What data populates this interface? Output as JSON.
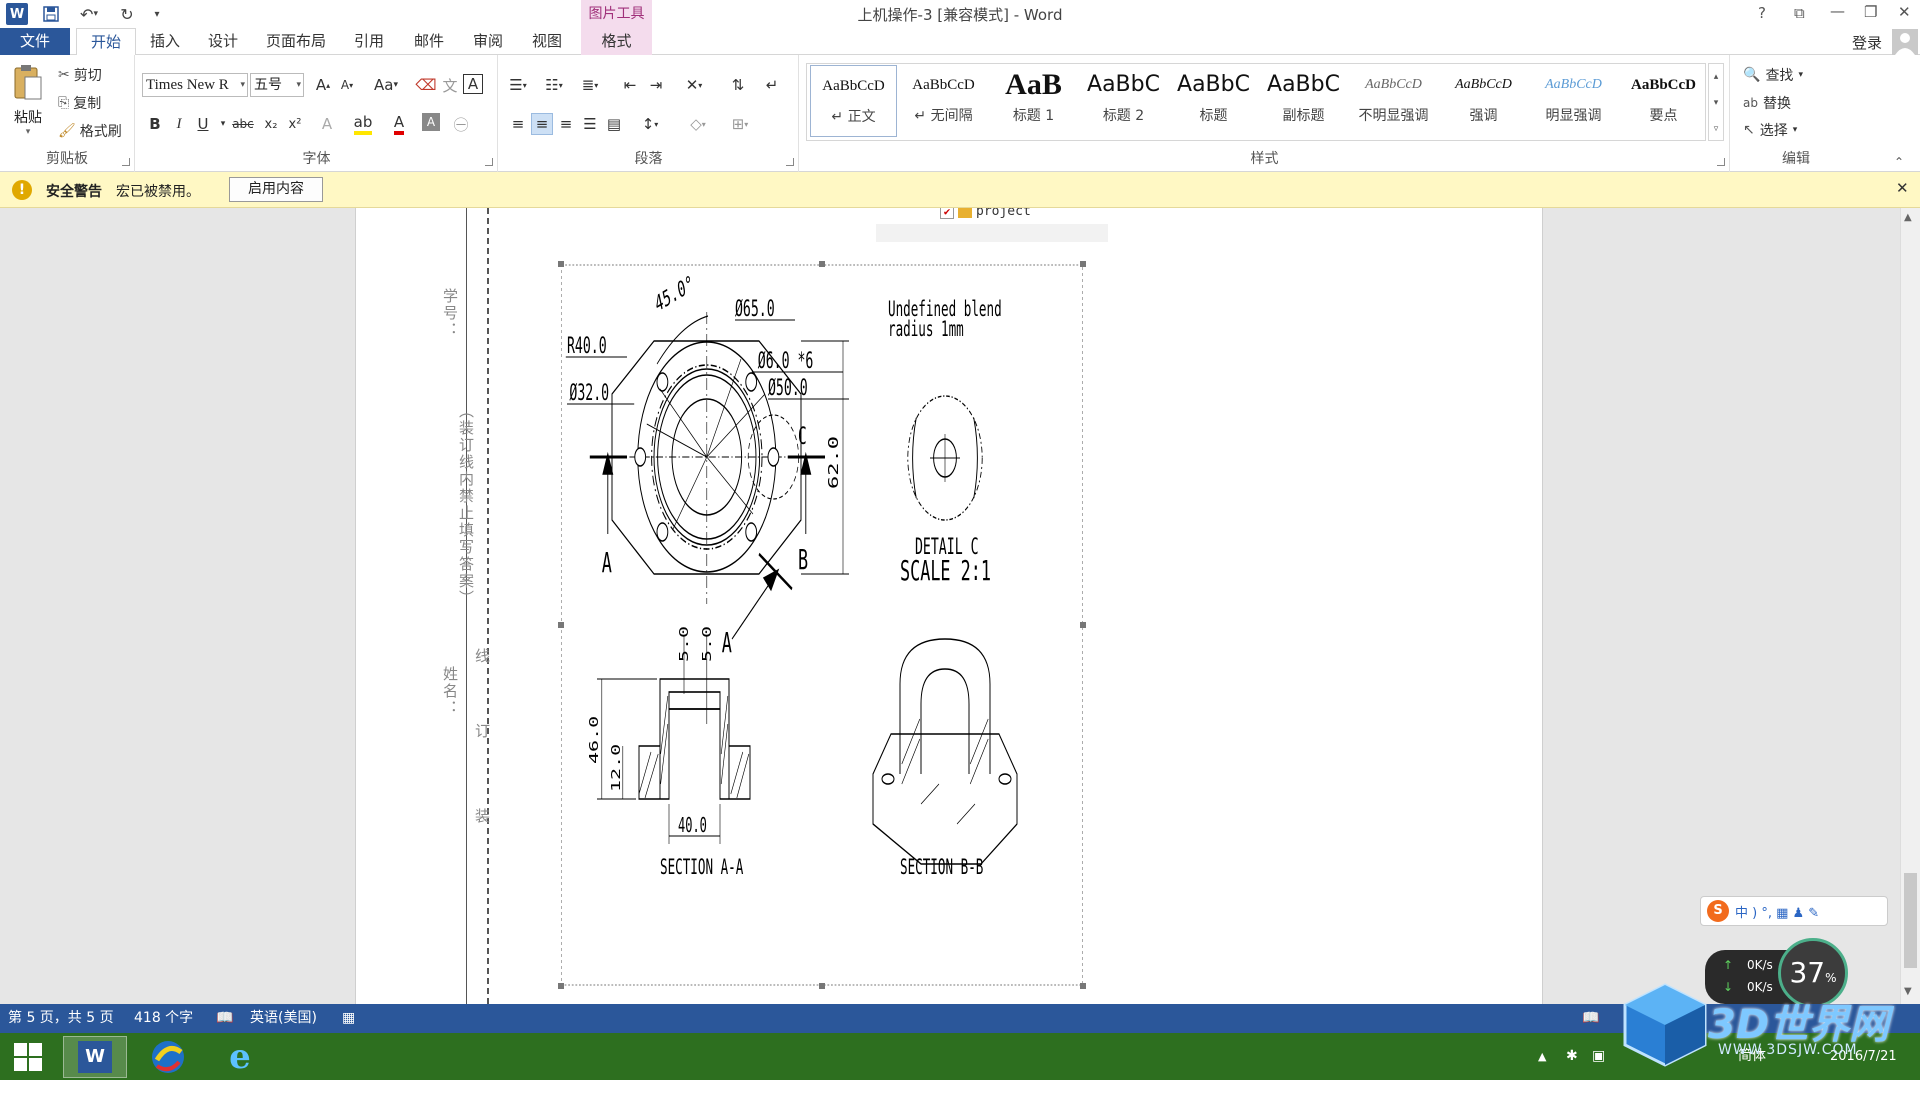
{
  "titlebar": {
    "title": "上机操作-3 [兼容模式] - Word",
    "help": "?",
    "minimize": "—",
    "restore": "❐",
    "close": "✕",
    "ribbon_display": "⧉"
  },
  "ribbon_tabs": {
    "file": "文件",
    "home": "开始",
    "insert": "插入",
    "design": "设计",
    "layout": "页面布局",
    "references": "引用",
    "mailings": "邮件",
    "review": "审阅",
    "view": "视图",
    "context_header": "图片工具",
    "format": "格式",
    "login": "登录"
  },
  "clipboard": {
    "paste": "粘贴",
    "cut": "剪切",
    "copy": "复制",
    "format_painter": "格式刷",
    "group_label": "剪贴板"
  },
  "font": {
    "name": "Times New R",
    "size": "五号",
    "grow": "A",
    "shrink": "A",
    "case": "Aa",
    "bold": "B",
    "italic": "I",
    "underline": "U",
    "strike": "abc",
    "subscript": "x₂",
    "superscript": "x²",
    "group_label": "字体"
  },
  "paragraph": {
    "group_label": "段落"
  },
  "styles": {
    "group_label": "样式",
    "items": [
      {
        "sample": "AaBbCcD",
        "name": "↵ 正文"
      },
      {
        "sample": "AaBbCcD",
        "name": "↵ 无间隔"
      },
      {
        "sample": "AaB",
        "name": "标题 1"
      },
      {
        "sample": "AaBbC",
        "name": "标题 2"
      },
      {
        "sample": "AaBbC",
        "name": "标题"
      },
      {
        "sample": "AaBbC",
        "name": "副标题"
      },
      {
        "sample": "AaBbCcD",
        "name": "不明显强调"
      },
      {
        "sample": "AaBbCcD",
        "name": "强调"
      },
      {
        "sample": "AaBbCcD",
        "name": "明显强调"
      },
      {
        "sample": "AaBbCcD",
        "name": "要点"
      }
    ]
  },
  "editing": {
    "find": "查找",
    "replace": "替换",
    "select": "选择",
    "group_label": "编辑"
  },
  "security": {
    "title": "安全警告",
    "message": "宏已被禁用。",
    "enable_button": "启用内容"
  },
  "document": {
    "margin_xuehao": "学号：",
    "margin_note": "（装订线内禁止填写答案）",
    "margin_xingming": "姓名：",
    "margin_xian": "线",
    "margin_ding": "订",
    "margin_zhuang": "装",
    "tree_item": "project",
    "drawing": {
      "angle": "45.0°",
      "d65": "Ø65.0",
      "r40": "R40.0",
      "d6": "Ø6.0 *6",
      "d50": "Ø50.0",
      "d32": "Ø32.0",
      "height62": "62.0",
      "label_c": "C",
      "label_a_left": "A",
      "label_b": "B",
      "label_a_bottom": "A",
      "note": [
        "Undefined blend",
        "radius 1mm"
      ],
      "detail_title": "DETAIL C",
      "detail_scale": "SCALE 2:1",
      "dim_5a": "5.0",
      "dim_5b": "5.0",
      "dim_46": "46.0",
      "dim_12": "12.0",
      "dim_40": "40.0",
      "section_aa": "SECTION A-A",
      "section_bb": "SECTION B-B"
    }
  },
  "ime": {
    "text": "中 ) °, ▦ ♟ ✎",
    "lang": "中"
  },
  "net": {
    "up": "0K/s",
    "down": "0K/s",
    "percent": "37"
  },
  "watermark": {
    "main": "3D世界网",
    "url": "WWW.3DSJW.COM"
  },
  "statusbar": {
    "page": "第 5 页，共 5 页",
    "words": "418 个字",
    "lang": "英语(美国)"
  },
  "taskbar": {
    "date": "2016/7/21",
    "ime_tray": "简体"
  },
  "colors": {
    "word_blue": "#2b579a",
    "security_bg": "#fff8c4",
    "taskbar": "#2d6f1f",
    "context_pink": "#f4dced"
  }
}
